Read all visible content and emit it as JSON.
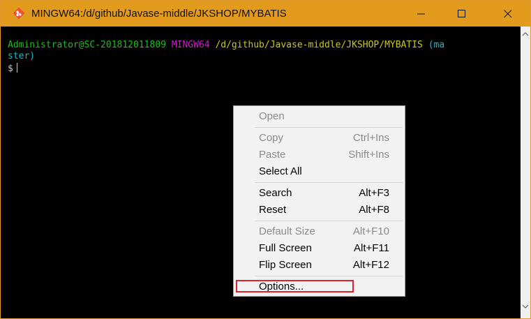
{
  "window": {
    "title": "MINGW64:/d/github/Javase-middle/JKSHOP/MYBATIS",
    "icon": "git-bash-icon",
    "titlebar_color": "#e39b1e"
  },
  "terminal": {
    "user_host": "Administrator@SC-201812011809",
    "env": "MINGW64",
    "path": "/d/github/Javase-middle/JKSHOP/MYBATIS",
    "branch_part1": "(ma",
    "branch_part2": "ster)",
    "prompt": "$"
  },
  "context_menu": {
    "items": [
      {
        "label": "Open",
        "shortcut": "",
        "disabled": true
      },
      {
        "label": "Copy",
        "shortcut": "Ctrl+Ins",
        "disabled": true
      },
      {
        "label": "Paste",
        "shortcut": "Shift+Ins",
        "disabled": true
      },
      {
        "label": "Select All",
        "shortcut": "",
        "disabled": false
      },
      {
        "label": "Search",
        "shortcut": "Alt+F3",
        "disabled": false
      },
      {
        "label": "Reset",
        "shortcut": "Alt+F8",
        "disabled": false
      },
      {
        "label": "Default Size",
        "shortcut": "Alt+F10",
        "disabled": true
      },
      {
        "label": "Full Screen",
        "shortcut": "Alt+F11",
        "disabled": false
      },
      {
        "label": "Flip Screen",
        "shortcut": "Alt+F12",
        "disabled": false
      },
      {
        "label": "Options...",
        "shortcut": "",
        "disabled": false
      }
    ],
    "highlight_color": "#e0202a"
  }
}
